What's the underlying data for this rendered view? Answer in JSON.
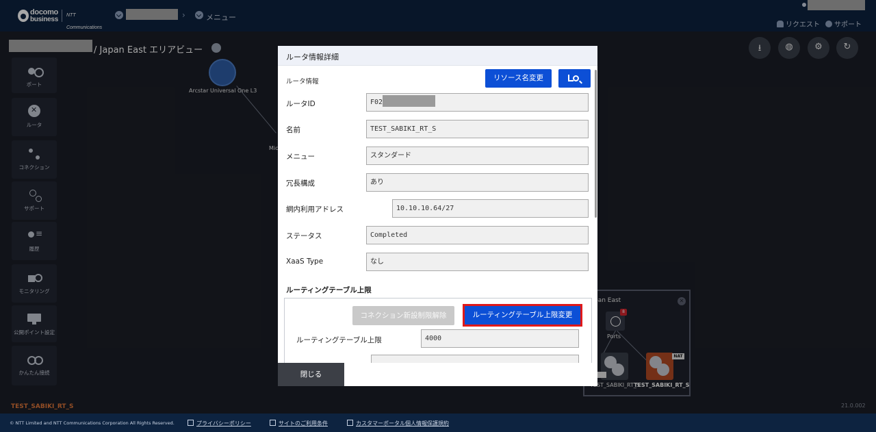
{
  "header": {
    "logo_line1": "docomo",
    "logo_line2": "business",
    "ntt_logo": "NTT Communications",
    "breadcrumb_menu": "メニュー",
    "request_link": "リクエスト",
    "support_link": "サポート"
  },
  "page": {
    "title": "/ Japan East エリアビュー"
  },
  "rail": {
    "items": [
      {
        "label": "ポート",
        "icon": "port-icon"
      },
      {
        "label": "ルータ",
        "icon": "router-icon"
      },
      {
        "label": "コネクション",
        "icon": "connection-icon"
      },
      {
        "label": "サポート",
        "icon": "support-icon"
      },
      {
        "label": "履歴",
        "icon": "history-icon"
      },
      {
        "label": "モニタリング",
        "icon": "monitoring-icon"
      },
      {
        "label": "公開ポイント設定",
        "icon": "monitor-icon"
      },
      {
        "label": "かんたん接続",
        "icon": "easy-connect-icon"
      }
    ]
  },
  "canvas": {
    "globe_label": "Arcstar Universal One L3",
    "mic_label": "Mic",
    "tools": [
      "download-icon",
      "globe-icon",
      "gear-icon",
      "refresh-icon"
    ]
  },
  "minimap": {
    "title": "pan East",
    "close": "✕",
    "ports_label": "Ports",
    "badge": "8",
    "nat": "NAT",
    "router1_label": "TEST_SABIKI_RT_S",
    "router2_label": "TEST_SABIKI_RT_S"
  },
  "status": {
    "selected_name": "TEST_SABIKI_RT_S",
    "version": "21.0.002"
  },
  "footer": {
    "copyright": "© NTT Limited and NTT Communications Corporation All Rights Reserved.",
    "links": [
      "プライバシーポリシー",
      "サイトのご利用条件",
      "カスタマーポータル個人情報保護規約"
    ]
  },
  "modal": {
    "title": "ルータ情報詳細",
    "section_label": "ルータ情報",
    "rename_button": "リソース名変更",
    "fields": [
      {
        "label": "ルータID",
        "value": "F02"
      },
      {
        "label": "名前",
        "value": "TEST_SABIKI_RT_S"
      },
      {
        "label": "メニュー",
        "value": "スタンダード"
      },
      {
        "label": "冗長構成",
        "value": "あり"
      },
      {
        "label": "網内利用アドレス",
        "value": "10.10.10.64/27"
      },
      {
        "label": "ステータス",
        "value": "Completed"
      },
      {
        "label": "XaaS Type",
        "value": "なし"
      }
    ],
    "routing": {
      "heading": "ルーティングテーブル上限",
      "release_button": "コネクション新設制限解除",
      "change_button": "ルーティングテーブル上限変更",
      "limit_label": "ルーティングテーブル上限",
      "limit_value": "4000"
    },
    "close_button": "閉じる"
  }
}
